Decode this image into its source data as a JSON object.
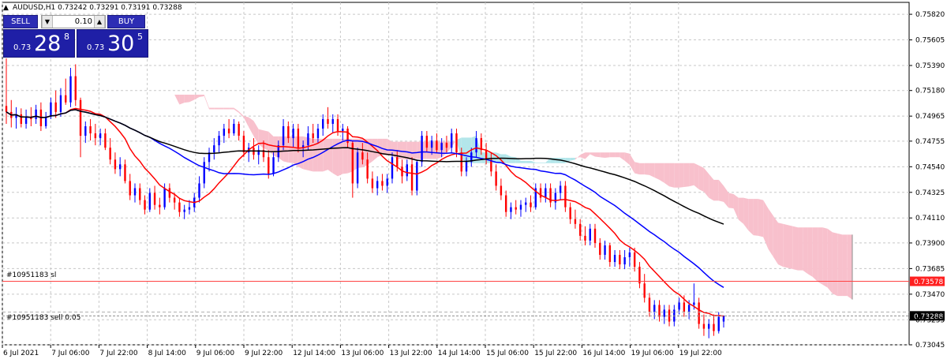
{
  "header": {
    "title": "AUDUSD,H1  0.73242 0.73291 0.73191 0.73288"
  },
  "trade_panel": {
    "sell_label": "SELL",
    "buy_label": "BUY",
    "lot": "0.10",
    "sell_price": {
      "small": "0.73",
      "big": "28",
      "sup": "8"
    },
    "buy_price": {
      "small": "0.73",
      "big": "30",
      "sup": "5"
    }
  },
  "order_labels": {
    "sl": "#10951183 sl",
    "entry": "#10951183 sell 0.05"
  },
  "colors": {
    "bull": "#0000ff",
    "bear": "#ff0000",
    "sl_line": "#ff4444",
    "cloud_up": "#b3e6ea",
    "cloud_down": "#f8c0cc",
    "ma_fast": "#ff0000",
    "ma_mid": "#0000ff",
    "ma_slow": "#000000"
  },
  "chart_data": {
    "type": "candlestick",
    "symbol": "AUDUSD",
    "timeframe": "H1",
    "ylim": [
      0.73045,
      0.7592
    ],
    "y_ticks": [
      "0.75820",
      "0.75605",
      "0.75390",
      "0.75180",
      "0.74965",
      "0.74755",
      "0.74540",
      "0.74325",
      "0.74110",
      "0.73900",
      "0.73685",
      "0.73470",
      "0.73255",
      "0.73045"
    ],
    "x_ticks": [
      "6 Jul 2021",
      "7 Jul 06:00",
      "7 Jul 22:00",
      "8 Jul 14:00",
      "9 Jul 06:00",
      "9 Jul 22:00",
      "12 Jul 14:00",
      "13 Jul 06:00",
      "13 Jul 22:00",
      "14 Jul 14:00",
      "15 Jul 06:00",
      "15 Jul 22:00",
      "16 Jul 14:00",
      "19 Jul 06:00",
      "19 Jul 22:00"
    ],
    "current_price": "0.73288",
    "sl_price": "0.73578",
    "candles": [
      {
        "o": 0.7505,
        "h": 0.7545,
        "l": 0.749,
        "c": 0.75
      },
      {
        "o": 0.75,
        "h": 0.751,
        "l": 0.7487,
        "c": 0.7495
      },
      {
        "o": 0.7495,
        "h": 0.7504,
        "l": 0.7486,
        "c": 0.7498
      },
      {
        "o": 0.7498,
        "h": 0.7503,
        "l": 0.7487,
        "c": 0.749
      },
      {
        "o": 0.749,
        "h": 0.7502,
        "l": 0.7486,
        "c": 0.7496
      },
      {
        "o": 0.7496,
        "h": 0.7504,
        "l": 0.7488,
        "c": 0.7494
      },
      {
        "o": 0.7494,
        "h": 0.7506,
        "l": 0.749,
        "c": 0.7502
      },
      {
        "o": 0.7502,
        "h": 0.7508,
        "l": 0.7484,
        "c": 0.7488
      },
      {
        "o": 0.7488,
        "h": 0.75,
        "l": 0.7486,
        "c": 0.7496
      },
      {
        "o": 0.7496,
        "h": 0.7512,
        "l": 0.7494,
        "c": 0.7508
      },
      {
        "o": 0.7508,
        "h": 0.7518,
        "l": 0.7495,
        "c": 0.75
      },
      {
        "o": 0.75,
        "h": 0.752,
        "l": 0.7496,
        "c": 0.7514
      },
      {
        "o": 0.7514,
        "h": 0.7528,
        "l": 0.7506,
        "c": 0.7508
      },
      {
        "o": 0.7508,
        "h": 0.7537,
        "l": 0.7504,
        "c": 0.753
      },
      {
        "o": 0.753,
        "h": 0.754,
        "l": 0.7505,
        "c": 0.751
      },
      {
        "o": 0.751,
        "h": 0.7512,
        "l": 0.7462,
        "c": 0.748
      },
      {
        "o": 0.748,
        "h": 0.7492,
        "l": 0.7474,
        "c": 0.7488
      },
      {
        "o": 0.7488,
        "h": 0.7494,
        "l": 0.7476,
        "c": 0.7482
      },
      {
        "o": 0.7482,
        "h": 0.749,
        "l": 0.7472,
        "c": 0.7478
      },
      {
        "o": 0.7478,
        "h": 0.7486,
        "l": 0.7472,
        "c": 0.7482
      },
      {
        "o": 0.7482,
        "h": 0.7486,
        "l": 0.7468,
        "c": 0.747
      },
      {
        "o": 0.747,
        "h": 0.7478,
        "l": 0.7456,
        "c": 0.746
      },
      {
        "o": 0.746,
        "h": 0.7466,
        "l": 0.7448,
        "c": 0.7452
      },
      {
        "o": 0.7452,
        "h": 0.7462,
        "l": 0.7446,
        "c": 0.7456
      },
      {
        "o": 0.7456,
        "h": 0.746,
        "l": 0.744,
        "c": 0.7442
      },
      {
        "o": 0.7442,
        "h": 0.7448,
        "l": 0.7426,
        "c": 0.743
      },
      {
        "o": 0.743,
        "h": 0.744,
        "l": 0.7424,
        "c": 0.7436
      },
      {
        "o": 0.7436,
        "h": 0.744,
        "l": 0.7422,
        "c": 0.7426
      },
      {
        "o": 0.7426,
        "h": 0.743,
        "l": 0.7414,
        "c": 0.7418
      },
      {
        "o": 0.7418,
        "h": 0.7436,
        "l": 0.7416,
        "c": 0.7432
      },
      {
        "o": 0.7432,
        "h": 0.7438,
        "l": 0.7418,
        "c": 0.7422
      },
      {
        "o": 0.7422,
        "h": 0.7428,
        "l": 0.7414,
        "c": 0.742
      },
      {
        "o": 0.742,
        "h": 0.744,
        "l": 0.7418,
        "c": 0.7436
      },
      {
        "o": 0.7436,
        "h": 0.744,
        "l": 0.7424,
        "c": 0.7428
      },
      {
        "o": 0.7428,
        "h": 0.7432,
        "l": 0.7418,
        "c": 0.7424
      },
      {
        "o": 0.7424,
        "h": 0.7428,
        "l": 0.7412,
        "c": 0.7416
      },
      {
        "o": 0.7416,
        "h": 0.7422,
        "l": 0.741,
        "c": 0.7418
      },
      {
        "o": 0.7418,
        "h": 0.7426,
        "l": 0.7414,
        "c": 0.742
      },
      {
        "o": 0.742,
        "h": 0.7432,
        "l": 0.7416,
        "c": 0.7428
      },
      {
        "o": 0.7428,
        "h": 0.7446,
        "l": 0.7424,
        "c": 0.744
      },
      {
        "o": 0.744,
        "h": 0.7462,
        "l": 0.7436,
        "c": 0.7458
      },
      {
        "o": 0.7458,
        "h": 0.747,
        "l": 0.745,
        "c": 0.7466
      },
      {
        "o": 0.7466,
        "h": 0.7478,
        "l": 0.746,
        "c": 0.7472
      },
      {
        "o": 0.7472,
        "h": 0.7484,
        "l": 0.7466,
        "c": 0.748
      },
      {
        "o": 0.748,
        "h": 0.749,
        "l": 0.7474,
        "c": 0.7486
      },
      {
        "o": 0.7486,
        "h": 0.7494,
        "l": 0.7478,
        "c": 0.7482
      },
      {
        "o": 0.7482,
        "h": 0.7494,
        "l": 0.748,
        "c": 0.749
      },
      {
        "o": 0.749,
        "h": 0.7492,
        "l": 0.7476,
        "c": 0.748
      },
      {
        "o": 0.748,
        "h": 0.7484,
        "l": 0.7462,
        "c": 0.7466
      },
      {
        "o": 0.7466,
        "h": 0.7474,
        "l": 0.7458,
        "c": 0.747
      },
      {
        "o": 0.747,
        "h": 0.7478,
        "l": 0.746,
        "c": 0.7464
      },
      {
        "o": 0.7464,
        "h": 0.7472,
        "l": 0.7456,
        "c": 0.7468
      },
      {
        "o": 0.7468,
        "h": 0.7476,
        "l": 0.7458,
        "c": 0.7462
      },
      {
        "o": 0.7462,
        "h": 0.7468,
        "l": 0.7444,
        "c": 0.7448
      },
      {
        "o": 0.7448,
        "h": 0.7466,
        "l": 0.7446,
        "c": 0.7462
      },
      {
        "o": 0.7462,
        "h": 0.7476,
        "l": 0.7458,
        "c": 0.7472
      },
      {
        "o": 0.7472,
        "h": 0.7494,
        "l": 0.7468,
        "c": 0.7488
      },
      {
        "o": 0.7488,
        "h": 0.7492,
        "l": 0.7474,
        "c": 0.7478
      },
      {
        "o": 0.7478,
        "h": 0.749,
        "l": 0.747,
        "c": 0.7486
      },
      {
        "o": 0.7486,
        "h": 0.749,
        "l": 0.7466,
        "c": 0.747
      },
      {
        "o": 0.747,
        "h": 0.7476,
        "l": 0.7462,
        "c": 0.7472
      },
      {
        "o": 0.7472,
        "h": 0.7488,
        "l": 0.7468,
        "c": 0.7482
      },
      {
        "o": 0.7482,
        "h": 0.749,
        "l": 0.7474,
        "c": 0.7478
      },
      {
        "o": 0.7478,
        "h": 0.749,
        "l": 0.7474,
        "c": 0.7486
      },
      {
        "o": 0.7486,
        "h": 0.7498,
        "l": 0.748,
        "c": 0.7494
      },
      {
        "o": 0.7494,
        "h": 0.7504,
        "l": 0.7486,
        "c": 0.749
      },
      {
        "o": 0.749,
        "h": 0.7498,
        "l": 0.7482,
        "c": 0.7494
      },
      {
        "o": 0.7494,
        "h": 0.7498,
        "l": 0.748,
        "c": 0.7484
      },
      {
        "o": 0.7484,
        "h": 0.749,
        "l": 0.7476,
        "c": 0.7486
      },
      {
        "o": 0.7486,
        "h": 0.7488,
        "l": 0.747,
        "c": 0.7474
      },
      {
        "o": 0.7474,
        "h": 0.7476,
        "l": 0.7428,
        "c": 0.744
      },
      {
        "o": 0.744,
        "h": 0.747,
        "l": 0.7436,
        "c": 0.7466
      },
      {
        "o": 0.7466,
        "h": 0.7474,
        "l": 0.7456,
        "c": 0.746
      },
      {
        "o": 0.746,
        "h": 0.7466,
        "l": 0.744,
        "c": 0.7444
      },
      {
        "o": 0.7444,
        "h": 0.745,
        "l": 0.7432,
        "c": 0.7436
      },
      {
        "o": 0.7436,
        "h": 0.7446,
        "l": 0.743,
        "c": 0.7442
      },
      {
        "o": 0.7442,
        "h": 0.7448,
        "l": 0.7434,
        "c": 0.7438
      },
      {
        "o": 0.7438,
        "h": 0.7448,
        "l": 0.7432,
        "c": 0.7444
      },
      {
        "o": 0.7444,
        "h": 0.7466,
        "l": 0.744,
        "c": 0.7462
      },
      {
        "o": 0.7462,
        "h": 0.7468,
        "l": 0.745,
        "c": 0.7454
      },
      {
        "o": 0.7454,
        "h": 0.746,
        "l": 0.744,
        "c": 0.7446
      },
      {
        "o": 0.7446,
        "h": 0.746,
        "l": 0.7442,
        "c": 0.7456
      },
      {
        "o": 0.7456,
        "h": 0.7462,
        "l": 0.743,
        "c": 0.7434
      },
      {
        "o": 0.7434,
        "h": 0.746,
        "l": 0.743,
        "c": 0.7458
      },
      {
        "o": 0.7458,
        "h": 0.7484,
        "l": 0.7454,
        "c": 0.748
      },
      {
        "o": 0.748,
        "h": 0.7484,
        "l": 0.7466,
        "c": 0.747
      },
      {
        "o": 0.747,
        "h": 0.748,
        "l": 0.7464,
        "c": 0.7476
      },
      {
        "o": 0.7476,
        "h": 0.7482,
        "l": 0.7466,
        "c": 0.7468
      },
      {
        "o": 0.7468,
        "h": 0.7478,
        "l": 0.7462,
        "c": 0.7474
      },
      {
        "o": 0.7474,
        "h": 0.748,
        "l": 0.7466,
        "c": 0.747
      },
      {
        "o": 0.747,
        "h": 0.7486,
        "l": 0.7466,
        "c": 0.7482
      },
      {
        "o": 0.7482,
        "h": 0.7486,
        "l": 0.7462,
        "c": 0.7466
      },
      {
        "o": 0.7466,
        "h": 0.747,
        "l": 0.7446,
        "c": 0.745
      },
      {
        "o": 0.745,
        "h": 0.7462,
        "l": 0.7446,
        "c": 0.7458
      },
      {
        "o": 0.7458,
        "h": 0.747,
        "l": 0.7454,
        "c": 0.7466
      },
      {
        "o": 0.7466,
        "h": 0.7484,
        "l": 0.7462,
        "c": 0.7478
      },
      {
        "o": 0.7478,
        "h": 0.7482,
        "l": 0.7464,
        "c": 0.7468
      },
      {
        "o": 0.7468,
        "h": 0.7474,
        "l": 0.7456,
        "c": 0.746
      },
      {
        "o": 0.746,
        "h": 0.7466,
        "l": 0.7446,
        "c": 0.745
      },
      {
        "o": 0.745,
        "h": 0.7456,
        "l": 0.7434,
        "c": 0.7438
      },
      {
        "o": 0.7438,
        "h": 0.7444,
        "l": 0.7426,
        "c": 0.743
      },
      {
        "o": 0.743,
        "h": 0.7434,
        "l": 0.7412,
        "c": 0.7416
      },
      {
        "o": 0.7416,
        "h": 0.7424,
        "l": 0.741,
        "c": 0.742
      },
      {
        "o": 0.742,
        "h": 0.7426,
        "l": 0.7414,
        "c": 0.7418
      },
      {
        "o": 0.7418,
        "h": 0.7426,
        "l": 0.7412,
        "c": 0.7422
      },
      {
        "o": 0.7422,
        "h": 0.7428,
        "l": 0.7416,
        "c": 0.7424
      },
      {
        "o": 0.7424,
        "h": 0.743,
        "l": 0.7416,
        "c": 0.742
      },
      {
        "o": 0.742,
        "h": 0.744,
        "l": 0.7418,
        "c": 0.7436
      },
      {
        "o": 0.7436,
        "h": 0.744,
        "l": 0.7424,
        "c": 0.7428
      },
      {
        "o": 0.7428,
        "h": 0.744,
        "l": 0.7424,
        "c": 0.7436
      },
      {
        "o": 0.7436,
        "h": 0.744,
        "l": 0.742,
        "c": 0.7424
      },
      {
        "o": 0.7424,
        "h": 0.7436,
        "l": 0.7418,
        "c": 0.7432
      },
      {
        "o": 0.7432,
        "h": 0.7442,
        "l": 0.7426,
        "c": 0.7438
      },
      {
        "o": 0.7438,
        "h": 0.7442,
        "l": 0.7416,
        "c": 0.742
      },
      {
        "o": 0.742,
        "h": 0.7424,
        "l": 0.7406,
        "c": 0.741
      },
      {
        "o": 0.741,
        "h": 0.7418,
        "l": 0.7402,
        "c": 0.7406
      },
      {
        "o": 0.7406,
        "h": 0.741,
        "l": 0.7392,
        "c": 0.7396
      },
      {
        "o": 0.7396,
        "h": 0.7404,
        "l": 0.7388,
        "c": 0.7392
      },
      {
        "o": 0.7392,
        "h": 0.7406,
        "l": 0.7388,
        "c": 0.7402
      },
      {
        "o": 0.7402,
        "h": 0.7406,
        "l": 0.7386,
        "c": 0.739
      },
      {
        "o": 0.739,
        "h": 0.7394,
        "l": 0.7376,
        "c": 0.738
      },
      {
        "o": 0.738,
        "h": 0.7392,
        "l": 0.7376,
        "c": 0.7388
      },
      {
        "o": 0.7388,
        "h": 0.739,
        "l": 0.737,
        "c": 0.7374
      },
      {
        "o": 0.7374,
        "h": 0.7384,
        "l": 0.737,
        "c": 0.738
      },
      {
        "o": 0.738,
        "h": 0.7384,
        "l": 0.7368,
        "c": 0.7372
      },
      {
        "o": 0.7372,
        "h": 0.7384,
        "l": 0.7368,
        "c": 0.7378
      },
      {
        "o": 0.7378,
        "h": 0.7386,
        "l": 0.737,
        "c": 0.7382
      },
      {
        "o": 0.7382,
        "h": 0.7386,
        "l": 0.7366,
        "c": 0.737
      },
      {
        "o": 0.737,
        "h": 0.7374,
        "l": 0.7352,
        "c": 0.7356
      },
      {
        "o": 0.7356,
        "h": 0.7364,
        "l": 0.734,
        "c": 0.7344
      },
      {
        "o": 0.7344,
        "h": 0.7348,
        "l": 0.7328,
        "c": 0.7332
      },
      {
        "o": 0.7332,
        "h": 0.7342,
        "l": 0.7326,
        "c": 0.7338
      },
      {
        "o": 0.7338,
        "h": 0.7342,
        "l": 0.7324,
        "c": 0.7328
      },
      {
        "o": 0.7328,
        "h": 0.7338,
        "l": 0.7322,
        "c": 0.7334
      },
      {
        "o": 0.7334,
        "h": 0.7338,
        "l": 0.732,
        "c": 0.7324
      },
      {
        "o": 0.7324,
        "h": 0.7338,
        "l": 0.732,
        "c": 0.7334
      },
      {
        "o": 0.7334,
        "h": 0.7344,
        "l": 0.733,
        "c": 0.734
      },
      {
        "o": 0.734,
        "h": 0.7346,
        "l": 0.7328,
        "c": 0.7332
      },
      {
        "o": 0.7332,
        "h": 0.7342,
        "l": 0.7326,
        "c": 0.7338
      },
      {
        "o": 0.7338,
        "h": 0.7356,
        "l": 0.7334,
        "c": 0.734
      },
      {
        "o": 0.734,
        "h": 0.7344,
        "l": 0.7318,
        "c": 0.7322
      },
      {
        "o": 0.7322,
        "h": 0.733,
        "l": 0.7312,
        "c": 0.7318
      },
      {
        "o": 0.7318,
        "h": 0.7326,
        "l": 0.731,
        "c": 0.7322
      },
      {
        "o": 0.7322,
        "h": 0.733,
        "l": 0.7312,
        "c": 0.7316
      },
      {
        "o": 0.7316,
        "h": 0.7332,
        "l": 0.7314,
        "c": 0.7328
      },
      {
        "o": 0.7324,
        "h": 0.7329,
        "l": 0.7319,
        "c": 0.7329
      }
    ]
  }
}
